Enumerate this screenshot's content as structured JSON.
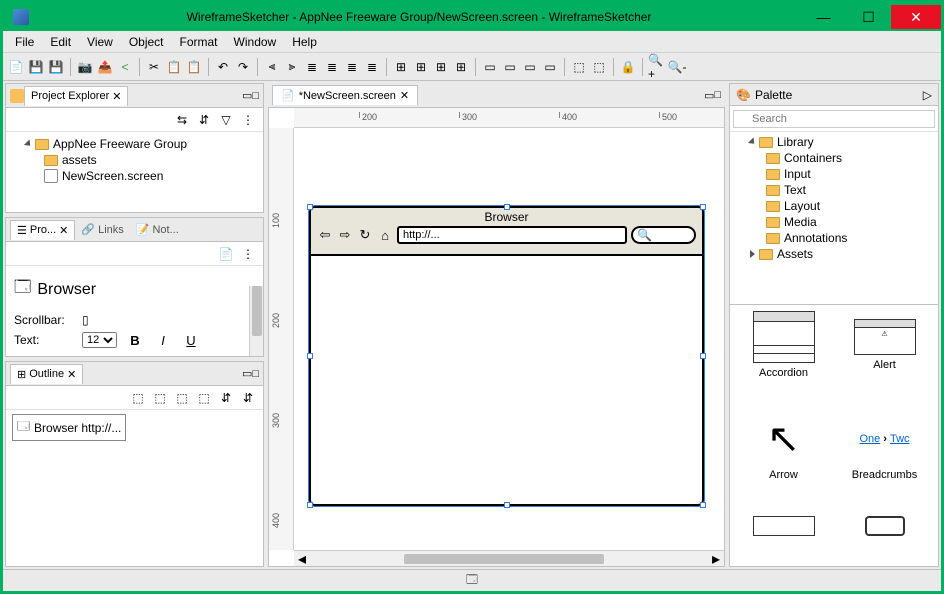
{
  "window": {
    "title": "WireframeSketcher - AppNee Freeware Group/NewScreen.screen - WireframeSketcher"
  },
  "menu": [
    "File",
    "Edit",
    "View",
    "Object",
    "Format",
    "Window",
    "Help"
  ],
  "project_explorer": {
    "tab_label": "Project Explorer",
    "root": "AppNee Freeware Group",
    "children": [
      "assets",
      "NewScreen.screen"
    ]
  },
  "properties": {
    "tabs": [
      "Pro...",
      "Links",
      "Not..."
    ],
    "widget_name": "Browser",
    "rows": {
      "scrollbar_label": "Scrollbar:",
      "text_label": "Text:",
      "font_size": "12"
    }
  },
  "outline": {
    "tab_label": "Outline",
    "item": "Browser http://..."
  },
  "editor": {
    "tab_label": "*NewScreen.screen",
    "ruler_h": [
      "200",
      "300",
      "400",
      "500"
    ],
    "ruler_v": [
      "100",
      "200",
      "300",
      "400"
    ],
    "browser_widget": {
      "title": "Browser",
      "url": "http://..."
    }
  },
  "palette": {
    "title": "Palette",
    "search_placeholder": "Search",
    "library_label": "Library",
    "categories": [
      "Containers",
      "Input",
      "Text",
      "Layout",
      "Media",
      "Annotations"
    ],
    "assets_label": "Assets",
    "items": [
      "Accordion",
      "Alert",
      "Arrow",
      "Breadcrumbs"
    ],
    "breadcrumb_sample": [
      "One",
      "Twc"
    ]
  }
}
